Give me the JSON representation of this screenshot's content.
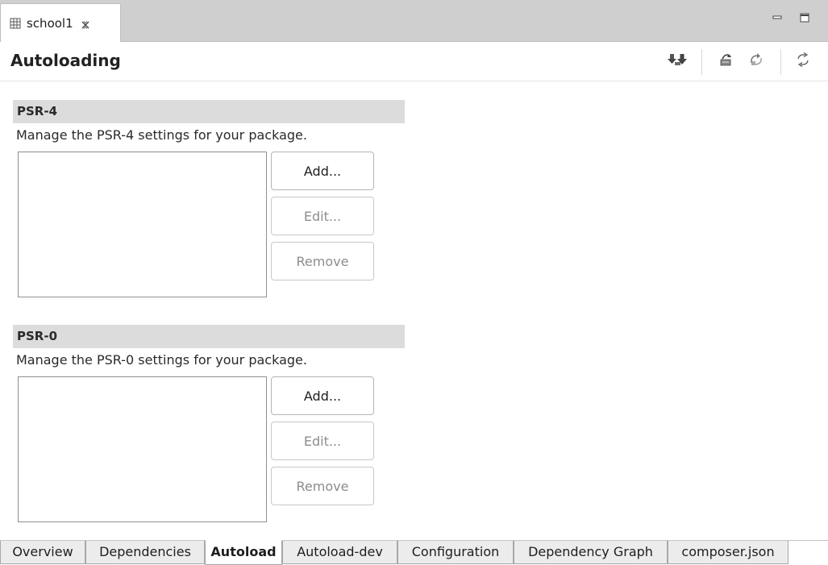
{
  "editor_tab": {
    "label": "school1",
    "icon": "grid-icon",
    "close_icon": "close-icon"
  },
  "window_controls": {
    "minimize_icon": "minimize-icon",
    "maximize_icon": "maximize-icon"
  },
  "form_header": {
    "title": "Autoloading",
    "toolbar_icons": [
      "install-icon",
      "update-icon",
      "dump-autoload-icon",
      "self-update-icon",
      "refresh-icon"
    ]
  },
  "psr4": {
    "title": "PSR-4",
    "description": "Manage the PSR-4 settings for your package.",
    "items": [],
    "add_label": "Add...",
    "edit_label": "Edit...",
    "remove_label": "Remove",
    "edit_enabled": false,
    "remove_enabled": false
  },
  "psr0": {
    "title": "PSR-0",
    "description": "Manage the PSR-0 settings for your package.",
    "items": [],
    "add_label": "Add...",
    "edit_label": "Edit...",
    "remove_label": "Remove",
    "edit_enabled": false,
    "remove_enabled": false
  },
  "page_tabs": [
    {
      "label": "Overview",
      "active": false
    },
    {
      "label": "Dependencies",
      "active": false
    },
    {
      "label": "Autoload",
      "active": true
    },
    {
      "label": "Autoload-dev",
      "active": false
    },
    {
      "label": "Configuration",
      "active": false
    },
    {
      "label": "Dependency Graph",
      "active": false
    },
    {
      "label": "composer.json",
      "active": false
    }
  ]
}
